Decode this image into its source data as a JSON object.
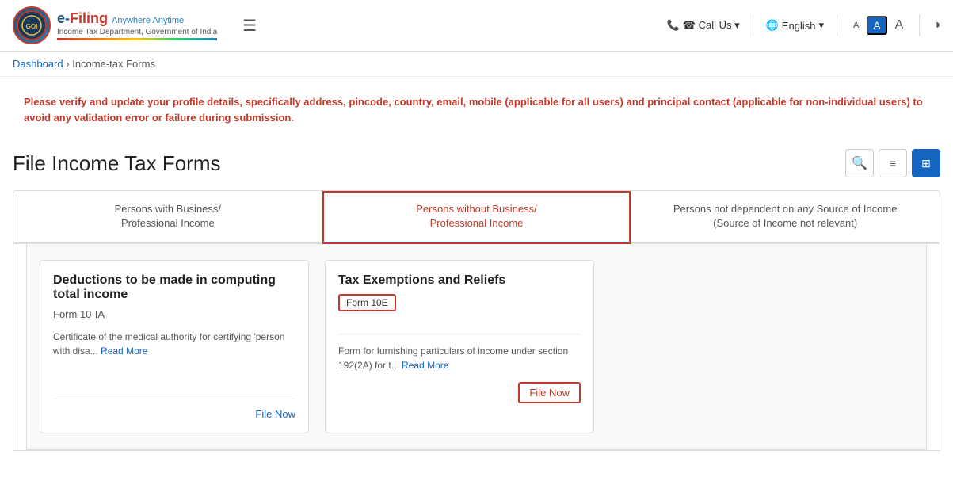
{
  "header": {
    "logo": {
      "circle_text": "GOI",
      "title_e": "e-",
      "title_filing": "Filing",
      "tagline": "Anywhere Anytime",
      "subtitle": "Income Tax Department, Government of India"
    },
    "menu_icon": "☰",
    "call_us": "☎ Call Us ▾",
    "globe_icon": "🌐",
    "language": "English",
    "language_arrow": "▾",
    "font_smaller": "A",
    "font_highlighted": "A",
    "font_larger": "A",
    "contrast_icon": "◑"
  },
  "breadcrumb": {
    "dashboard": "Dashboard",
    "separator": "›",
    "current": "Income-tax Forms"
  },
  "alert": {
    "text": "Please verify and update your profile details, specifically address, pincode, country, email, mobile (applicable for all users) and principal contact (applicable for non-individual users) to avoid any validation error or failure during submission."
  },
  "page_title": "File Income Tax Forms",
  "title_actions": {
    "search_icon": "🔍",
    "list_icon": "☰",
    "grid_icon": "⊞"
  },
  "tabs": [
    {
      "id": "tab1",
      "label": "Persons with Business/ Professional Income",
      "active": false
    },
    {
      "id": "tab2",
      "label": "Persons without Business/ Professional Income",
      "active": true
    },
    {
      "id": "tab3",
      "label": "Persons not dependent on any Source of Income (Source of Income not relevant)",
      "active": false
    }
  ],
  "cards": [
    {
      "id": "card1",
      "title": "Deductions to be made in computing total income",
      "form_label": "Form 10-IA",
      "desc": "Certificate of the medical authority for certifying 'person with disa...",
      "read_more": "Read More",
      "file_now": "File Now"
    },
    {
      "id": "card2",
      "title": "Tax Exemptions and Reliefs",
      "form_badge": "Form 10E",
      "desc_top": "Form for furnishing particulars of income under section 192(2A) for t...",
      "read_more": "Read More",
      "file_now": "File Now"
    }
  ]
}
